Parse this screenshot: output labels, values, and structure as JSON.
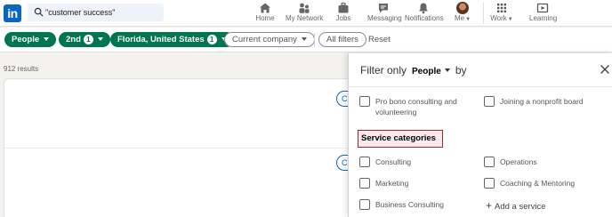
{
  "brand": {
    "logo_text": "in",
    "accent": "#0a66c2",
    "filter_green": "#01754f"
  },
  "search": {
    "value": "\"customer success\"",
    "icon": "search-icon"
  },
  "nav": {
    "items": [
      {
        "label": "Home",
        "icon": "home-icon"
      },
      {
        "label": "My Network",
        "icon": "network-icon"
      },
      {
        "label": "Jobs",
        "icon": "briefcase-icon"
      },
      {
        "label": "Messaging",
        "icon": "message-icon"
      },
      {
        "label": "Notifications",
        "icon": "bell-icon"
      },
      {
        "label": "Me",
        "icon": "avatar"
      },
      {
        "label": "Work",
        "icon": "grid-icon"
      },
      {
        "label": "Learning",
        "icon": "learning-icon"
      }
    ]
  },
  "filters": {
    "people": "People",
    "connection": {
      "label": "2nd",
      "count": "1"
    },
    "location": {
      "label": "Florida, United States",
      "count": "1"
    },
    "company": "Current company",
    "all_filters": "All filters",
    "reset": "Reset"
  },
  "results": {
    "count_text": "912 results",
    "connect_stub": "C"
  },
  "panel": {
    "title_prefix": "Filter only",
    "title_selected": "People",
    "title_suffix": "by",
    "row1": {
      "left": "Pro bono consulting and volunteering",
      "right": "Joining a nonprofit board"
    },
    "section_title": "Service categories",
    "services": [
      {
        "label": "Consulting",
        "checked": false
      },
      {
        "label": "Operations",
        "checked": false
      },
      {
        "label": "Marketing",
        "checked": false
      },
      {
        "label": "Coaching & Mentoring",
        "checked": false
      },
      {
        "label": "Business Consulting",
        "checked": false
      }
    ],
    "add_service": "Add a service"
  }
}
